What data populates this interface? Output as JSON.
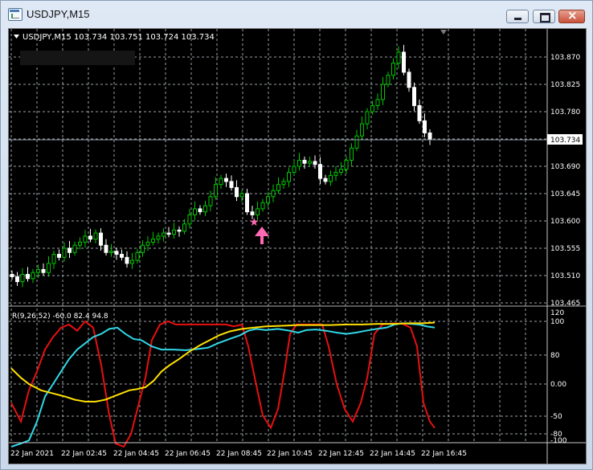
{
  "window": {
    "title": "USDJPY,M15"
  },
  "chart": {
    "header": "USDJPY,M15  103.734 103.751 103.724 103.734",
    "price_labels": [
      "103.870",
      "103.825",
      "103.780",
      "103.690",
      "103.645",
      "103.600",
      "103.555",
      "103.510",
      "103.465"
    ],
    "current_price": "103.734",
    "indicator_header": "R(9,26,52) -60.0 82.4 94.8",
    "indicator_labels": [
      "120",
      "100",
      "80",
      "0.00",
      "-50",
      "-80",
      "-100"
    ],
    "time_labels": [
      "22 Jan 2021",
      "22 Jan 02:45",
      "22 Jan 04:45",
      "22 Jan 06:45",
      "22 Jan 08:45",
      "22 Jan 10:45",
      "22 Jan 12:45",
      "22 Jan 14:45",
      "22 Jan 16:45"
    ],
    "colors": {
      "bull": "#00c800",
      "bear": "#ffffff",
      "red": "#e81010",
      "cyan": "#30d8e8",
      "yellow": "#ffe000",
      "arrow": "#ff69b4"
    }
  }
}
